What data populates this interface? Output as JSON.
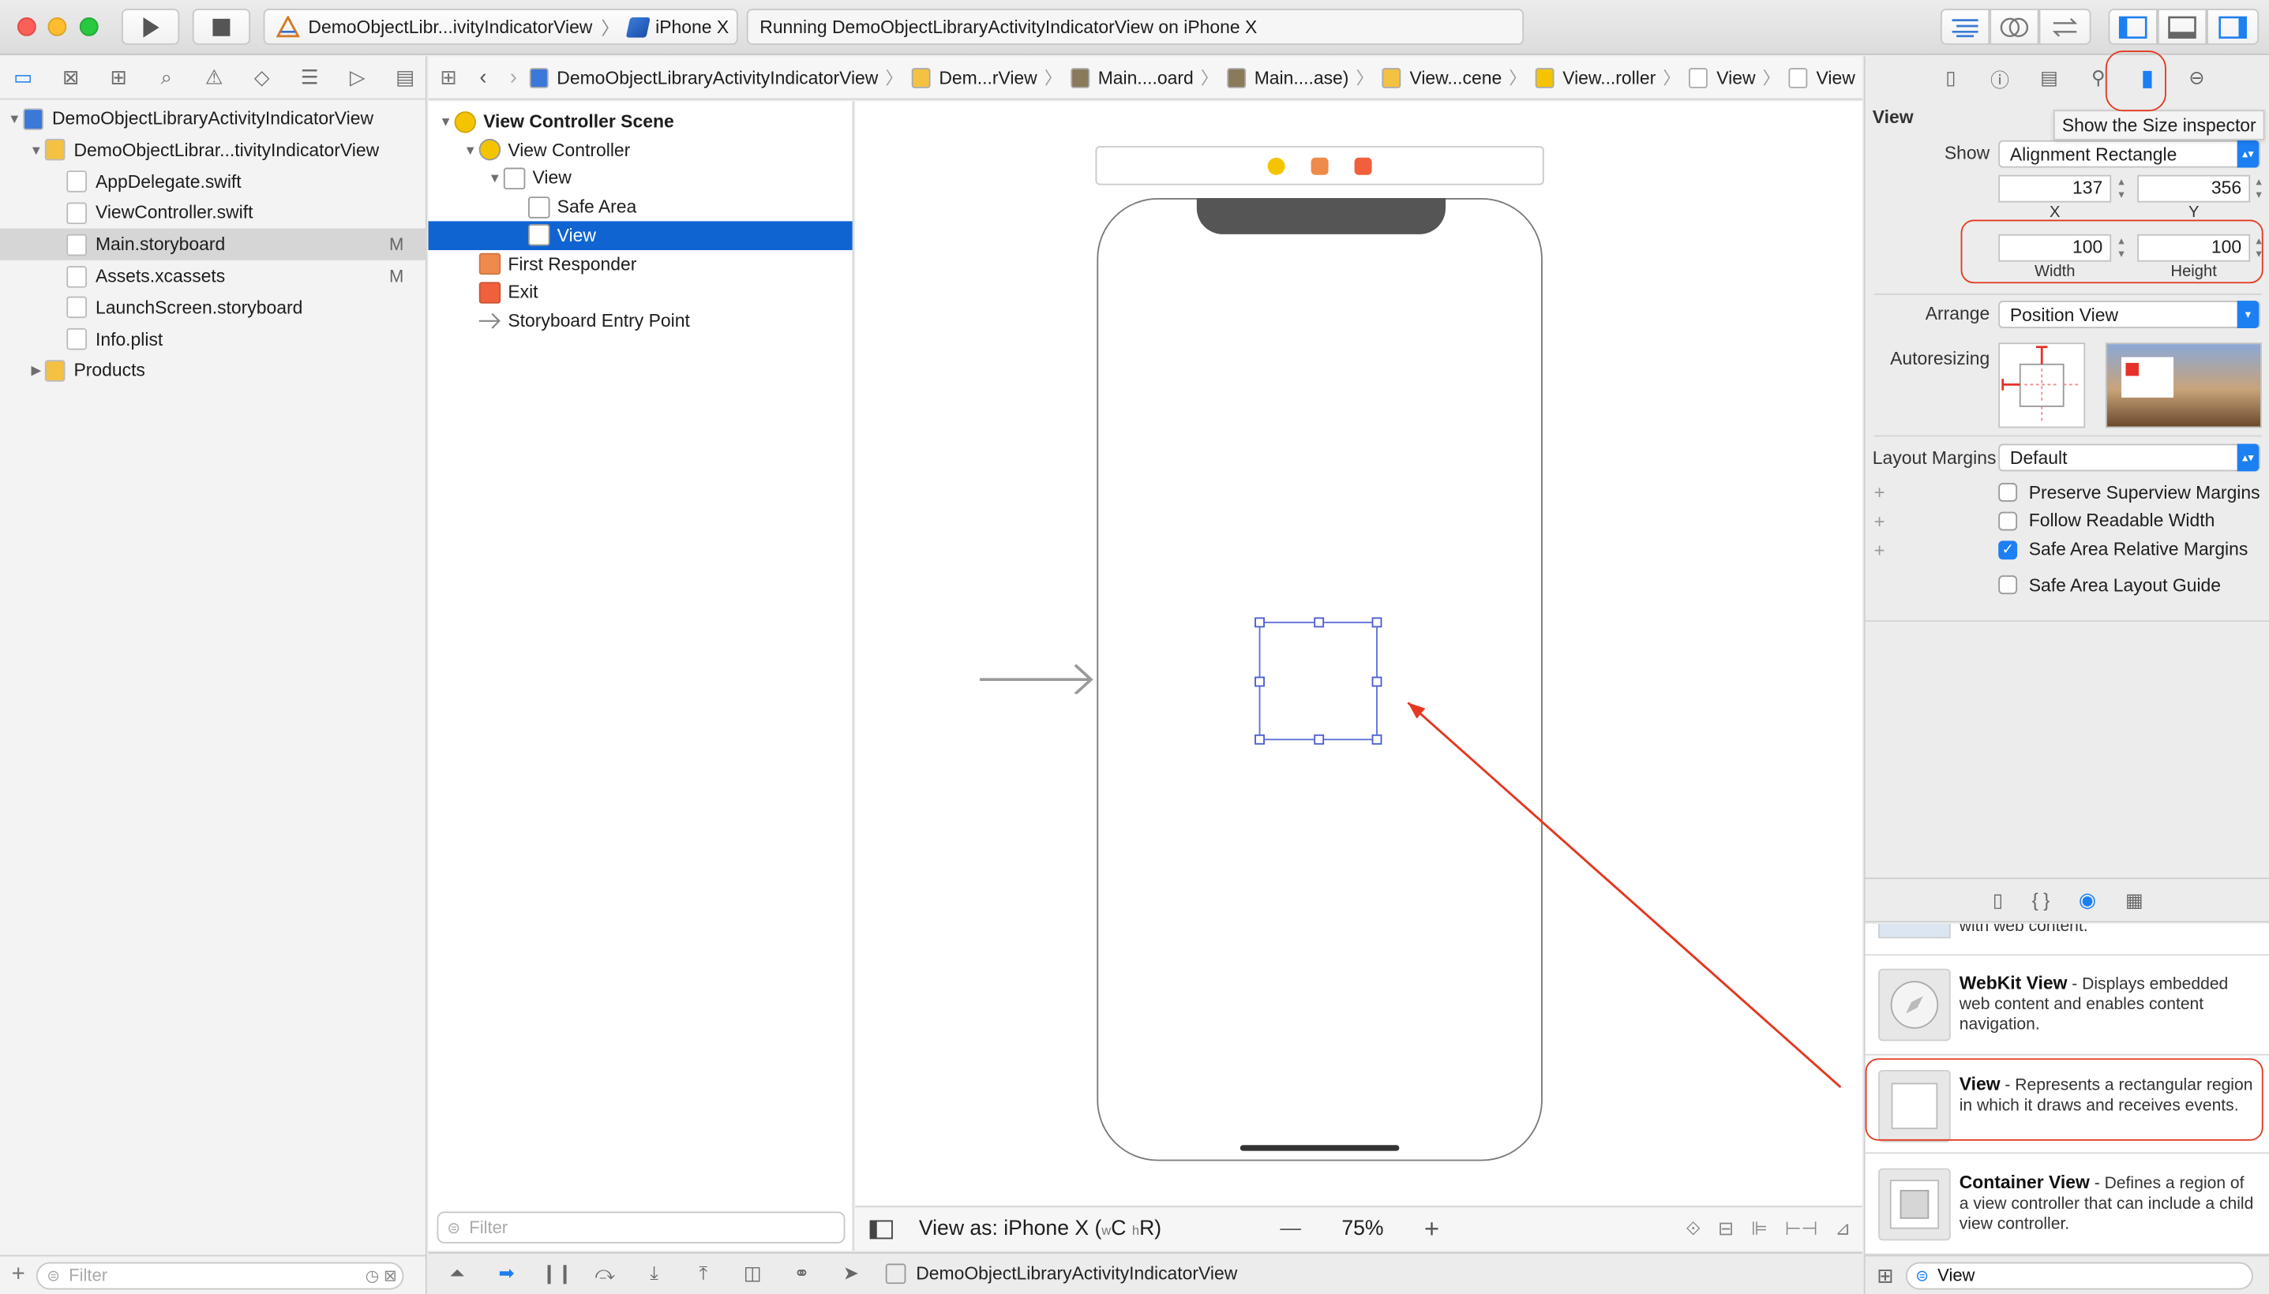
{
  "toolbar": {
    "scheme": "DemoObjectLibr...ivityIndicatorView",
    "device": "iPhone X",
    "activity": "Running DemoObjectLibraryActivityIndicatorView on iPhone X"
  },
  "navigator": {
    "items": [
      {
        "label": "DemoObjectLibraryActivityIndicatorView",
        "badge": "",
        "level": 0,
        "disclosure": "down",
        "icon": "project-icon",
        "selected": false
      },
      {
        "label": "DemoObjectLibrar...tivityIndicatorView",
        "badge": "",
        "level": 1,
        "disclosure": "down",
        "icon": "folder-icon",
        "selected": false
      },
      {
        "label": "AppDelegate.swift",
        "badge": "",
        "level": 2,
        "disclosure": "",
        "icon": "swift-file-icon",
        "selected": false
      },
      {
        "label": "ViewController.swift",
        "badge": "",
        "level": 2,
        "disclosure": "",
        "icon": "swift-file-icon",
        "selected": false
      },
      {
        "label": "Main.storyboard",
        "badge": "M",
        "level": 2,
        "disclosure": "",
        "icon": "storyboard-file-icon",
        "selected": true
      },
      {
        "label": "Assets.xcassets",
        "badge": "M",
        "level": 2,
        "disclosure": "",
        "icon": "assets-folder-icon",
        "selected": false
      },
      {
        "label": "LaunchScreen.storyboard",
        "badge": "",
        "level": 2,
        "disclosure": "",
        "icon": "storyboard-file-icon",
        "selected": false
      },
      {
        "label": "Info.plist",
        "badge": "",
        "level": 2,
        "disclosure": "",
        "icon": "plist-file-icon",
        "selected": false
      },
      {
        "label": "Products",
        "badge": "",
        "level": 1,
        "disclosure": "right",
        "icon": "folder-icon",
        "selected": false
      }
    ],
    "filter_placeholder": "Filter"
  },
  "jumpbar": {
    "crumbs": [
      "DemoObjectLibraryActivityIndicatorView",
      "Dem...rView",
      "Main....oard",
      "Main....ase)",
      "View...cene",
      "View...roller",
      "View",
      "View"
    ]
  },
  "outline": {
    "items": [
      {
        "label": "View Controller Scene",
        "level": 0,
        "disclosure": "down",
        "icon": "scene-icon",
        "selected": false,
        "bold": true
      },
      {
        "label": "View Controller",
        "level": 1,
        "disclosure": "down",
        "icon": "view-controller-icon",
        "selected": false,
        "bold": false
      },
      {
        "label": "View",
        "level": 2,
        "disclosure": "down",
        "icon": "view-icon",
        "selected": false,
        "bold": false
      },
      {
        "label": "Safe Area",
        "level": 3,
        "disclosure": "",
        "icon": "safe-area-icon",
        "selected": false,
        "bold": false
      },
      {
        "label": "View",
        "level": 3,
        "disclosure": "",
        "icon": "view-icon",
        "selected": true,
        "bold": false
      },
      {
        "label": "First Responder",
        "level": 1,
        "disclosure": "",
        "icon": "first-responder-icon",
        "selected": false,
        "bold": false
      },
      {
        "label": "Exit",
        "level": 1,
        "disclosure": "",
        "icon": "exit-icon",
        "selected": false,
        "bold": false
      },
      {
        "label": "Storyboard Entry Point",
        "level": 1,
        "disclosure": "",
        "icon": "entry-arrow-icon",
        "selected": false,
        "bold": false
      }
    ],
    "filter_placeholder": "Filter"
  },
  "canvas": {
    "view_as_prefix": "View as: iPhone X (",
    "view_as_w": "w",
    "view_as_c": "C",
    "view_as_h": "h",
    "view_as_r": "R)",
    "zoom": "75%",
    "zoom_out": "—",
    "zoom_in": "+"
  },
  "debugbar": {
    "target": "DemoObjectLibraryActivityIndicatorView"
  },
  "inspector": {
    "section_title": "View",
    "show_label": "Show",
    "show_value": "Alignment Rectangle",
    "x_value": "137",
    "y_value": "356",
    "x_label": "X",
    "y_label": "Y",
    "width_value": "100",
    "height_value": "100",
    "width_label": "Width",
    "height_label": "Height",
    "arrange_label": "Arrange",
    "arrange_value": "Position View",
    "autoresizing_label": "Autoresizing",
    "layout_margins_label": "Layout Margins",
    "layout_margins_value": "Default",
    "checkboxes": [
      {
        "label": "Preserve Superview Margins",
        "checked": false,
        "plus": true
      },
      {
        "label": "Follow Readable Width",
        "checked": false,
        "plus": true
      },
      {
        "label": "Safe Area Relative Margins",
        "checked": true,
        "plus": true
      },
      {
        "label": "Safe Area Layout Guide",
        "checked": false,
        "plus": false
      }
    ],
    "tooltip": "Show the Size inspector"
  },
  "library": {
    "partial_text": "with web content.",
    "items": [
      {
        "title": "WebKit View",
        "desc": " - Displays embedded web content and enables content navigation.",
        "icon": "webkit-compass-icon"
      },
      {
        "title": "View",
        "desc": " - Represents a rectangular region in which it draws and receives events.",
        "icon": "view-square-icon"
      },
      {
        "title": "Container View",
        "desc": " - Defines a region of a view controller that can include a child view controller.",
        "icon": "container-view-icon"
      }
    ],
    "search_value": "View"
  },
  "colors": {
    "selection_blue": "#0f64d2",
    "accent_blue": "#1c7ff2",
    "annotation_red": "#e4381f"
  }
}
